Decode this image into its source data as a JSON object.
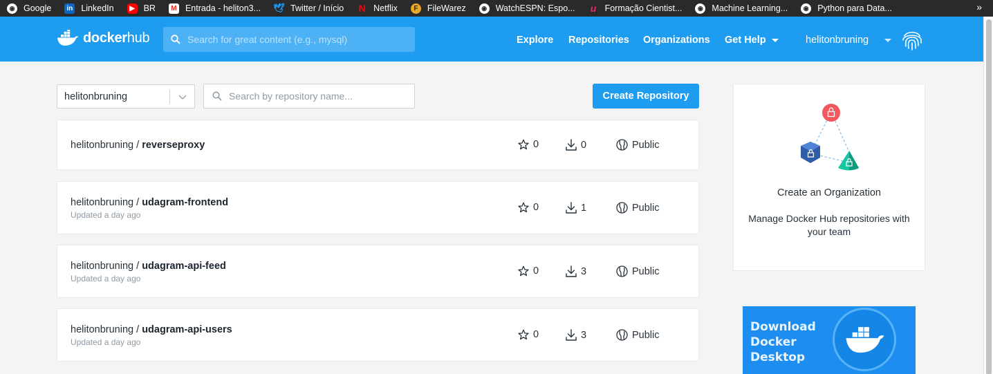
{
  "bookmarks": [
    {
      "label": "Google",
      "icon": "globe-icon"
    },
    {
      "label": "LinkedIn",
      "icon": "linkedin-icon",
      "color": "#0a66c2"
    },
    {
      "label": "BR",
      "icon": "youtube-icon",
      "color": "#ff0000"
    },
    {
      "label": "Entrada - heliton3...",
      "icon": "gmail-icon",
      "color": "#d93025"
    },
    {
      "label": "Twitter / Início",
      "icon": "twitter-icon",
      "color": "#1d9bf0"
    },
    {
      "label": "Netflix",
      "icon": "netflix-icon",
      "color": "#e50914"
    },
    {
      "label": "FileWarez",
      "icon": "filewarez-icon",
      "color": "#e9a826"
    },
    {
      "label": "WatchESPN: Espo...",
      "icon": "globe-icon"
    },
    {
      "label": "Formação Cientist...",
      "icon": "udemy-icon",
      "color": "#a435f0"
    },
    {
      "label": "Machine Learning...",
      "icon": "globe-icon"
    },
    {
      "label": "Python para Data...",
      "icon": "globe-icon"
    }
  ],
  "bookmarks_more": "»",
  "header": {
    "logo_text_1": "docker",
    "logo_text_2": "hub",
    "search_placeholder": "Search for great content (e.g., mysql)",
    "nav": [
      "Explore",
      "Repositories",
      "Organizations",
      "Get Help"
    ],
    "username": "helitonbruning"
  },
  "controls": {
    "namespace": "helitonbruning",
    "repo_search_placeholder": "Search by repository name...",
    "create_button": "Create Repository"
  },
  "repositories": [
    {
      "owner": "helitonbruning /",
      "name": "reverseproxy",
      "updated": "",
      "stars": "0",
      "pulls": "0",
      "visibility": "Public"
    },
    {
      "owner": "helitonbruning /",
      "name": "udagram-frontend",
      "updated": "Updated a day ago",
      "stars": "0",
      "pulls": "1",
      "visibility": "Public"
    },
    {
      "owner": "helitonbruning /",
      "name": "udagram-api-feed",
      "updated": "Updated a day ago",
      "stars": "0",
      "pulls": "3",
      "visibility": "Public"
    },
    {
      "owner": "helitonbruning /",
      "name": "udagram-api-users",
      "updated": "Updated a day ago",
      "stars": "0",
      "pulls": "3",
      "visibility": "Public"
    }
  ],
  "org_panel": {
    "title": "Create an Organization",
    "description": "Manage Docker Hub repositories with your team"
  },
  "download_banner": {
    "line1": "Download",
    "line2": "Docker",
    "line3": "Desktop"
  },
  "colors": {
    "brand_blue": "#1d9cf0",
    "bookmark_bar": "#2a2a2a",
    "page_bg": "#f4f4f4"
  }
}
